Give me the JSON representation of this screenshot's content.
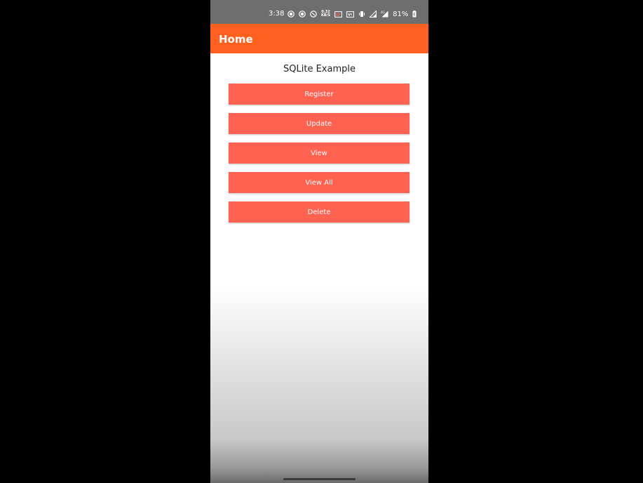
{
  "status_bar": {
    "time": "3:38",
    "net_speed_value": "0.32",
    "net_speed_unit": "KB/S",
    "battery": "81%",
    "icons": [
      "record-icon",
      "record-icon",
      "data-saver-icon",
      "net-speed",
      "cast-icon",
      "vowifi-icon",
      "vibrate-icon",
      "signal-icon",
      "signal-4g-icon",
      "battery-icon"
    ]
  },
  "app_bar": {
    "title": "Home",
    "color": "#ff5f1f"
  },
  "main": {
    "heading": "SQLite Example",
    "button_color": "#ff6251",
    "buttons": {
      "register": "Register",
      "update": "Update",
      "view": "View",
      "view_all": "View All",
      "delete": "Delete"
    }
  }
}
